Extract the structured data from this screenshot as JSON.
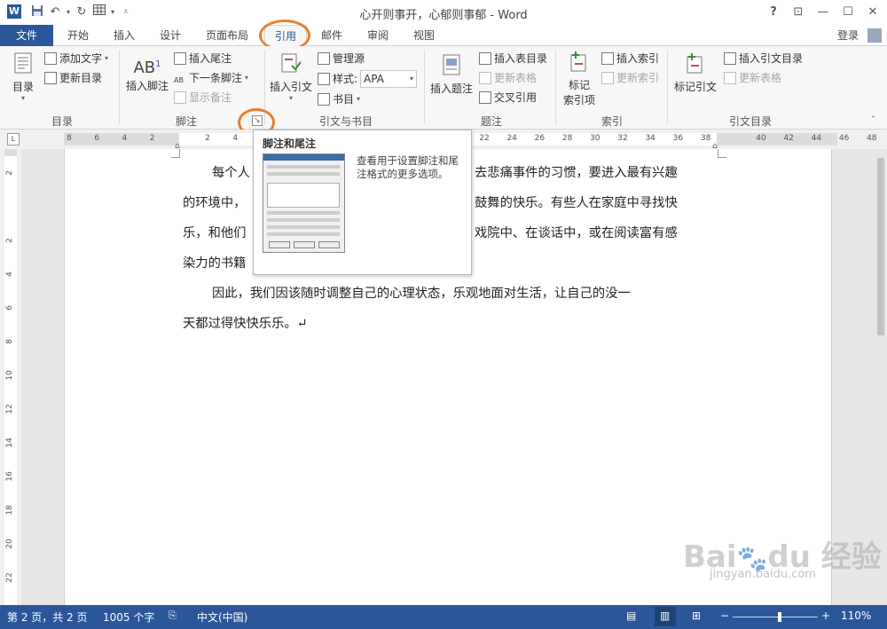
{
  "window": {
    "title": "心开则事开，心郁则事郁 - Word",
    "help": "?",
    "restore_ribbon": "⊡",
    "minimize": "—",
    "maximize": "☐",
    "close": "✕"
  },
  "quick_access": {
    "app_icon": "W",
    "save_icon": "save-icon",
    "undo_icon": "undo-icon",
    "redo_icon": "redo-icon",
    "table_icon": "table-icon",
    "customize_icon": "customize-icon"
  },
  "tabs": {
    "file": "文件",
    "items": [
      "开始",
      "插入",
      "设计",
      "页面布局",
      "引用",
      "邮件",
      "审阅",
      "视图"
    ],
    "active": "引用",
    "signin": "登录"
  },
  "ribbon": {
    "toc": {
      "big": "目录",
      "add_text": "添加文字",
      "update_toc": "更新目录",
      "label": "目录"
    },
    "footnotes": {
      "insert_footnote": "插入脚注",
      "insert_endnote": "插入尾注",
      "next_footnote": "下一条脚注",
      "show_notes": "显示备注",
      "label": "脚注"
    },
    "citations": {
      "insert_citation": "插入引文",
      "manage_sources": "管理源",
      "style_label": "样式:",
      "style_value": "APA",
      "bibliography": "书目",
      "label": "引文与书目"
    },
    "captions": {
      "insert_caption": "插入题注",
      "insert_table_of_figures": "插入表目录",
      "update_table": "更新表格",
      "cross_reference": "交叉引用",
      "label": "题注"
    },
    "index": {
      "mark_entry_line1": "标记",
      "mark_entry_line2": "索引项",
      "insert_index": "插入索引",
      "update_index": "更新索引",
      "label": "索引"
    },
    "toa": {
      "mark_citation": "标记引文",
      "insert_toa": "插入引文目录",
      "update_table": "更新表格",
      "label": "引文目录"
    }
  },
  "ruler": {
    "ticks": [
      "8",
      "6",
      "4",
      "2",
      "",
      "2",
      "4",
      "",
      "",
      "",
      "",
      "",
      "",
      "",
      "",
      "22",
      "24",
      "26",
      "28",
      "30",
      "32",
      "34",
      "36",
      "38",
      "",
      "40",
      "42",
      "44",
      "46",
      "48"
    ],
    "vticks": [
      "2",
      "",
      "2",
      "4",
      "6",
      "8",
      "10",
      "12",
      "14",
      "16",
      "18",
      "20",
      "22"
    ]
  },
  "document": {
    "lines": [
      "每个人……去悲痛事件的习惯，要进入最有兴趣",
      "的环境中，……鼓舞的快乐。有些人在家庭中寻找快",
      "乐，和他们……戏院中、在谈话中，或在阅读富有感",
      "染力的书籍……"
    ],
    "line_parts": [
      {
        "left": "每个人",
        "right": "去悲痛事件的习惯，要进入最有兴趣"
      },
      {
        "left": "的环境中，",
        "right": "鼓舞的快乐。有些人在家庭中寻找快"
      },
      {
        "left": "乐，和他们",
        "right": "戏院中、在谈话中，或在阅读富有感"
      },
      {
        "left": "染力的书籍",
        "right": ""
      }
    ],
    "para2_line1": "因此，我们因该随时调整自己的心理状态，乐观地面对生活，让自己的没一",
    "para2_line2": "天都过得快快乐乐。↵"
  },
  "tooltip": {
    "title": "脚注和尾注",
    "description": "查看用于设置脚注和尾注格式的更多选项。"
  },
  "status": {
    "page": "第 2 页，共 2 页",
    "words": "1005 个字",
    "language": "中文(中国)",
    "zoom": "110%",
    "zoom_level": 0.55
  },
  "watermark": {
    "text": "Bai du 经验",
    "url_text": "jingyan.baidu.com"
  },
  "colors": {
    "accent": "#2b579a",
    "highlight_ring": "#e97f2e"
  }
}
